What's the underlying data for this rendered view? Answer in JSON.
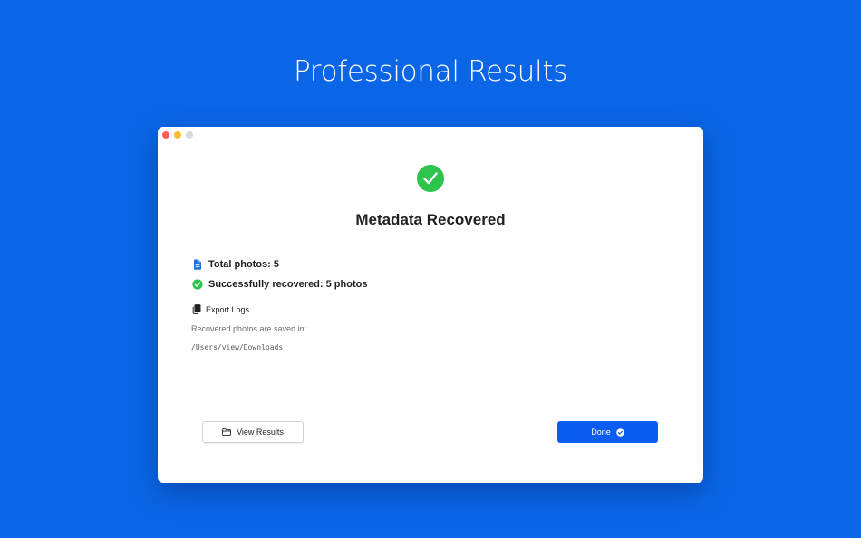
{
  "hero": {
    "title": "Professional Results"
  },
  "dialog": {
    "title": "Metadata Recovered",
    "total_photos": "Total photos: 5",
    "successfully_recovered": "Successfully recovered: 5 photos",
    "export_logs_label": "Export Logs",
    "saved_label": "Recovered photos are saved in:",
    "saved_path": "/Users/view/Downloads",
    "view_results_label": "View Results",
    "done_label": "Done"
  },
  "icons": {
    "status": "checkmark-circle-icon",
    "total": "document-icon",
    "recovered": "check-circle-icon",
    "export": "copy-document-icon",
    "view_results": "folder-icon",
    "done": "check-circle-icon"
  },
  "colors": {
    "background": "#0a66e6",
    "success": "#2cc44b",
    "accent": "#0a5cf5",
    "document_icon": "#1a73e8"
  }
}
